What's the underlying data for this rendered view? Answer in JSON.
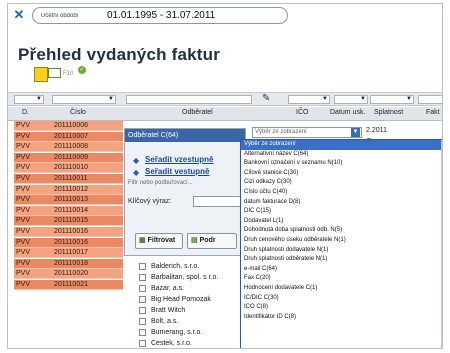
{
  "period": {
    "label": "Účetní období",
    "value": "01.01.1995 - 31.07.2011"
  },
  "page_title": "Přehled vydaných faktur",
  "toolbar": {
    "icon_caption": "F10",
    "ok_mark": "✓"
  },
  "grid": {
    "columns": [
      "D.",
      "Číslo",
      "Odběratel",
      "IČO",
      "Datum usk.",
      "Splatnost",
      "Fakt"
    ],
    "rows": [
      {
        "d": "PVV",
        "cislo": "201110006"
      },
      {
        "d": "PVV",
        "cislo": "201110007"
      },
      {
        "d": "PVV",
        "cislo": "201110008"
      },
      {
        "d": "PVV",
        "cislo": "201110009"
      },
      {
        "d": "PVV",
        "cislo": "201110010"
      },
      {
        "d": "PVV",
        "cislo": "201110011"
      },
      {
        "d": "PVV",
        "cislo": "201110012"
      },
      {
        "d": "PVV",
        "cislo": "201110013"
      },
      {
        "d": "PVV",
        "cislo": "201110014"
      },
      {
        "d": "PVV",
        "cislo": "201110015"
      },
      {
        "d": "PVV",
        "cislo": "201110016"
      },
      {
        "d": "PVV",
        "cislo": "201110016"
      },
      {
        "d": "PVV",
        "cislo": "201110017"
      },
      {
        "d": "PVV",
        "cislo": "201110018"
      },
      {
        "d": "PVV",
        "cislo": "201110020"
      },
      {
        "d": "PVV",
        "cislo": "201110021"
      }
    ],
    "first_date": "2.2011"
  },
  "subpanel": {
    "heading": "Odběratel C(64)",
    "sort_asc": "Seřadit vzestupně",
    "sort_desc": "Seřadit vestupně",
    "filter_label": "Filtr nebo podbuřovací...",
    "keyword_label": "Klíčový výraz:",
    "filter_button": "Filtrovat",
    "other_button": "Podr"
  },
  "customers": [
    "Balderich, s.r.o.",
    "Barbalitan, spol. s r.o.",
    "Bazar, a.s.",
    "Big Head Pomozak",
    "Bratt Witch",
    "Bolt, a.s.",
    "Bumerang, s.r.o.",
    "Cestek, s.r.o."
  ],
  "column_dropdown": {
    "selected": "Výběr ze zobrazení",
    "items": [
      "Výběr ze zobrazení",
      "Alternativní název C(64)",
      "Bankovní označení v seznamu N(10)",
      "Cílové stanice C(30)",
      "Cizí odkazy C(30)",
      "Číslo účtu C(40)",
      "datum fakturace D(8)",
      "DIČ C(15)",
      "Dodavatel L(1)",
      "Dohodnutá doba splatnosti odb. N(5)",
      "Druh cenového úseku odběratele N(1)",
      "Druh splatnosti dodavatele N(1)",
      "Druh splatnosti odběratele N(1)",
      "e-mail C(64)",
      "Fax C(20)",
      "Hodnocení dodavatele C(1)",
      "IČ/DIČ C(30)",
      "IČO C(8)",
      "Identifikátor ID C(8)"
    ]
  },
  "colors": {
    "row_fill": "#f3a37f",
    "accent_blue": "#3a6fc6",
    "title": "#1f2f46"
  }
}
